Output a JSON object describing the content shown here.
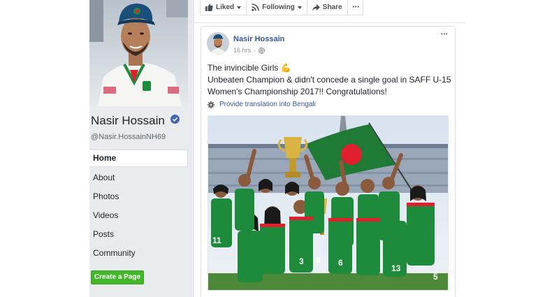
{
  "profile": {
    "name": "Nasir Hossain",
    "handle": "@Nasir.HossainNH69",
    "verified": true
  },
  "nav": {
    "items": [
      {
        "label": "Home",
        "active": true
      },
      {
        "label": "About"
      },
      {
        "label": "Photos"
      },
      {
        "label": "Videos"
      },
      {
        "label": "Posts"
      },
      {
        "label": "Community"
      }
    ]
  },
  "create_page_label": "Create a Page",
  "action_bar": {
    "liked_label": "Liked",
    "following_label": "Following",
    "share_label": "Share",
    "more_label": "•••"
  },
  "post": {
    "author": "Nasir Hossain",
    "time": "16 hrs",
    "privacy_icon": "globe-icon",
    "menu_label": "•••",
    "text_line1": "The invincible Girls 💪",
    "text_line2": "Unbeaten Champion & didn't concede a single goal in SAFF U-15",
    "text_line3": "Women's Championship 2017!! Congratulations!",
    "translate_label": "Provide translation into Bengali"
  },
  "colors": {
    "facebook_blue": "#4267b2",
    "link_blue": "#365899",
    "create_green": "#42b72a",
    "jersey_green": "#1e8a3c",
    "flag_red": "#e0202e"
  }
}
